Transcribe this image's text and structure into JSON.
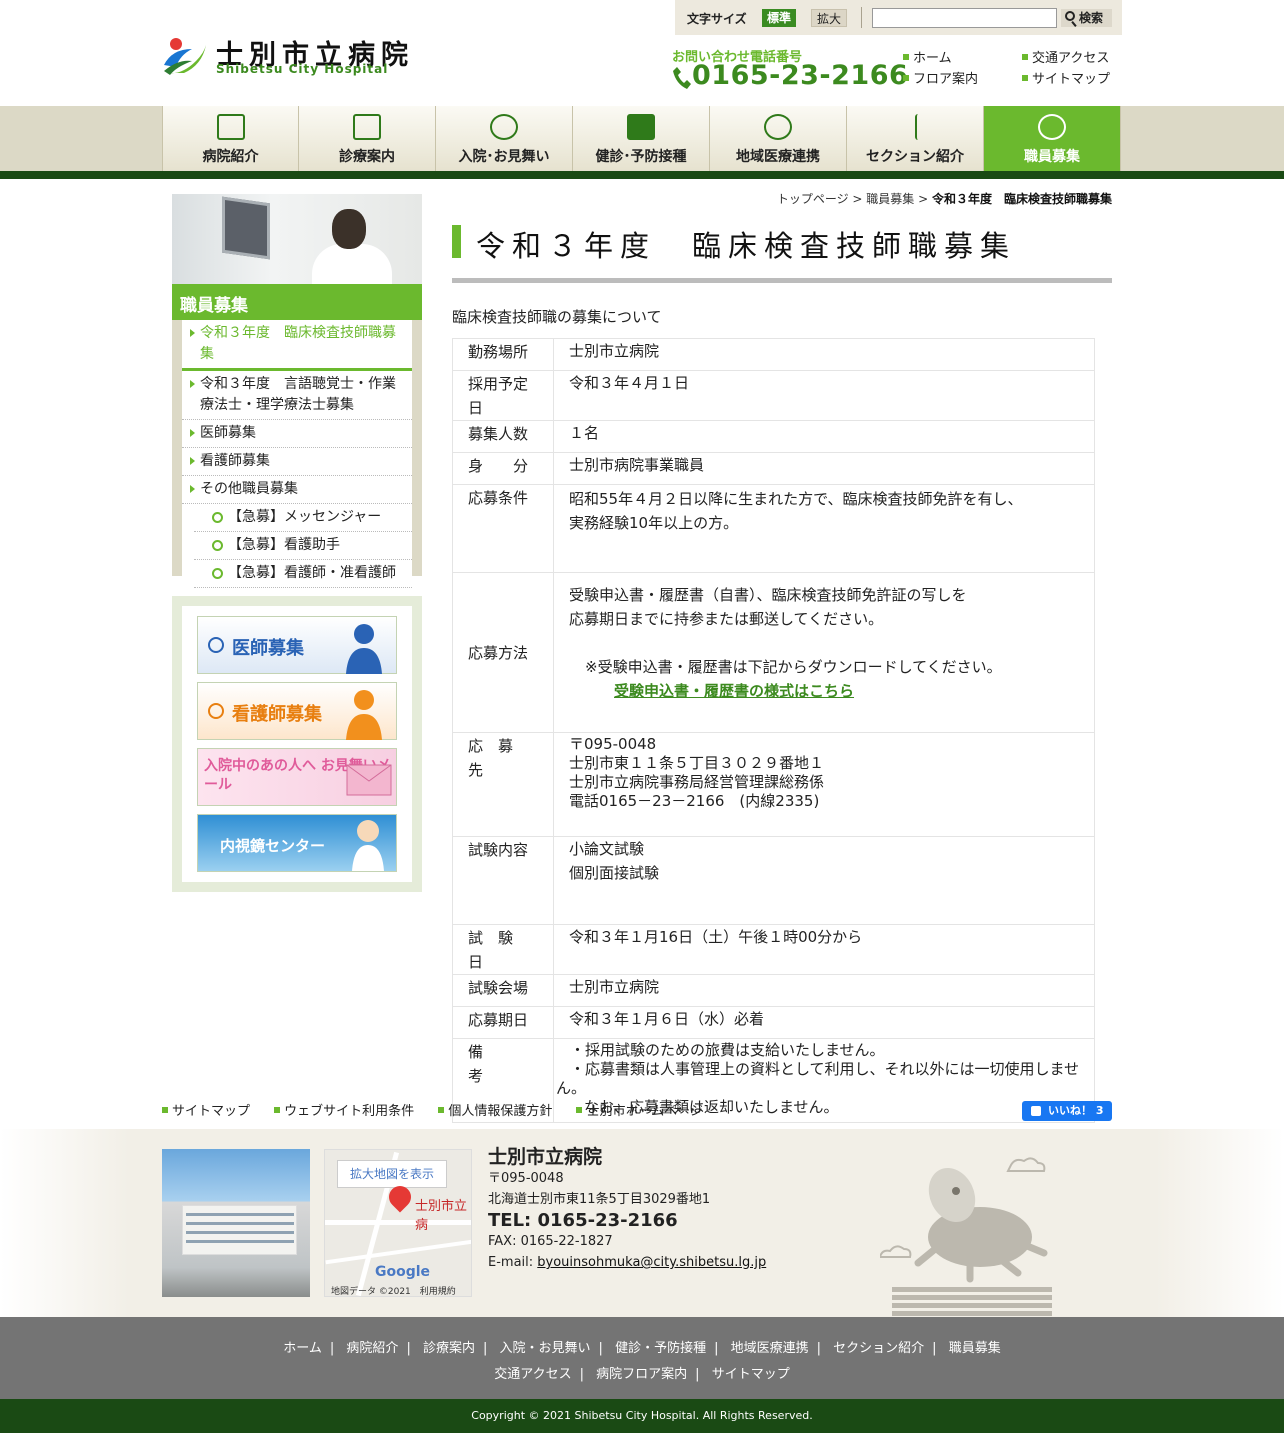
{
  "header": {
    "font_size_label": "文字サイズ",
    "font_standard": "標準",
    "font_large": "拡大",
    "search_button": "検索",
    "search_value": "",
    "logo_jp": "士別市立病院",
    "logo_en": "Shibetsu City Hospital",
    "tel_label": "お問い合わせ電話番号",
    "tel_number": "0165-23-2166",
    "links": [
      "ホーム",
      "交通アクセス",
      "フロア案内",
      "サイトマップ"
    ]
  },
  "nav": [
    "病院紹介",
    "診療案内",
    "入院･お見舞い",
    "健診･予防接種",
    "地域医療連携",
    "セクション紹介",
    "職員募集"
  ],
  "sidebar": {
    "title": "職員募集",
    "items": [
      "令和３年度　臨床検査技師職募集",
      "令和３年度　言語聴覚士・作業療法士・理学療法士募集",
      "医師募集",
      "看護師募集",
      "その他職員募集",
      "【急募】メッセンジャー",
      "【急募】看護助手",
      "【急募】看護師・准看護師"
    ]
  },
  "banners": [
    "医師募集",
    "看護師募集",
    "入院中のあの人へ お見舞いメール",
    "内視鏡センター"
  ],
  "breadcrumb": {
    "top": "トップページ",
    "sep": " > ",
    "parent": "職員募集",
    "current": "令和３年度　臨床検査技師職募集"
  },
  "page_title": "令和３年度　臨床検査技師職募集",
  "intro": "臨床検査技師職の募集について",
  "table": {
    "r1k": "勤務場所",
    "r1v": "士別市立病院",
    "r2k": "採用予定日",
    "r2v": "令和３年４月１日",
    "r3k": "募集人数",
    "r3v": "１名",
    "r4k": "身　　分",
    "r4v": "士別市病院事業職員",
    "r5k": "応募条件",
    "r5v1": "昭和55年４月２日以降に生まれた方で、臨床検査技師免許を有し、",
    "r5v2": "実務経験10年以上の方。",
    "r6k": "応募方法",
    "r6v1": "受験申込書・履歴書（自書）、臨床検査技師免許証の写しを",
    "r6v2": "応募期日までに持参または郵送してください。",
    "r6v3": "※受験申込書・履歴書は下記からダウンロードしてください。",
    "r6link": "受験申込書・履歴書の様式はこちら",
    "r7k": "応　募　先",
    "r7v1": "〒095-0048",
    "r7v2": "士別市東１１条５丁目３０２９番地１",
    "r7v3": "士別市立病院事務局経営管理課総務係",
    "r7v4": "電話0165－23－2166　(内線2335)",
    "r8k": "試験内容",
    "r8v1": "小論文試験",
    "r8v2": "個別面接試験",
    "r9k": "試　験　日",
    "r9v": "令和３年１月16日（土）午後１時00分から",
    "r10k": "試験会場",
    "r10v": "士別市立病院",
    "r11k": "応募期日",
    "r11v": "令和３年１月６日（水）必着",
    "r12k": "備　　　考",
    "r12v1": "・採用試験のための旅費は支給いたしません。",
    "r12v2": "・応募書類は人事管理上の資料として利用し、それ以外には一切使用しません。",
    "r12v3": "なお、応募書類は返却いたしません。"
  },
  "footer": {
    "links": [
      "サイトマップ",
      "ウェブサイト利用条件",
      "個人情報保護方針",
      "士別市ホームページ"
    ],
    "fb_label": "いいね！ 3",
    "map_button": "拡大地図を表示",
    "map_place": "士別市立病",
    "map_credit": "地図データ ©2021　利用規約",
    "map_google": "Google",
    "name": "士別市立病院",
    "zip": "〒095-0048",
    "address": "北海道士別市東11条5丁目3029番地1",
    "tel": "TEL: 0165-23-2166",
    "fax": "FAX: 0165-22-1827",
    "email_label": "E-mail: ",
    "email": "byouinsohmuka@city.shibetsu.lg.jp",
    "gnav1": [
      "ホーム",
      "病院紹介",
      "診療案内",
      "入院・お見舞い",
      "健診・予防接種",
      "地域医療連携",
      "セクション紹介",
      "職員募集"
    ],
    "gnav2": [
      "交通アクセス",
      "病院フロア案内",
      "サイトマップ"
    ],
    "copyright": "Copyright © 2021 Shibetsu City Hospital. All Rights Reserved."
  },
  "colors": {
    "accent": "#6bb92e",
    "dark_green": "#1a4a14",
    "beige": "#dcd9c6"
  }
}
